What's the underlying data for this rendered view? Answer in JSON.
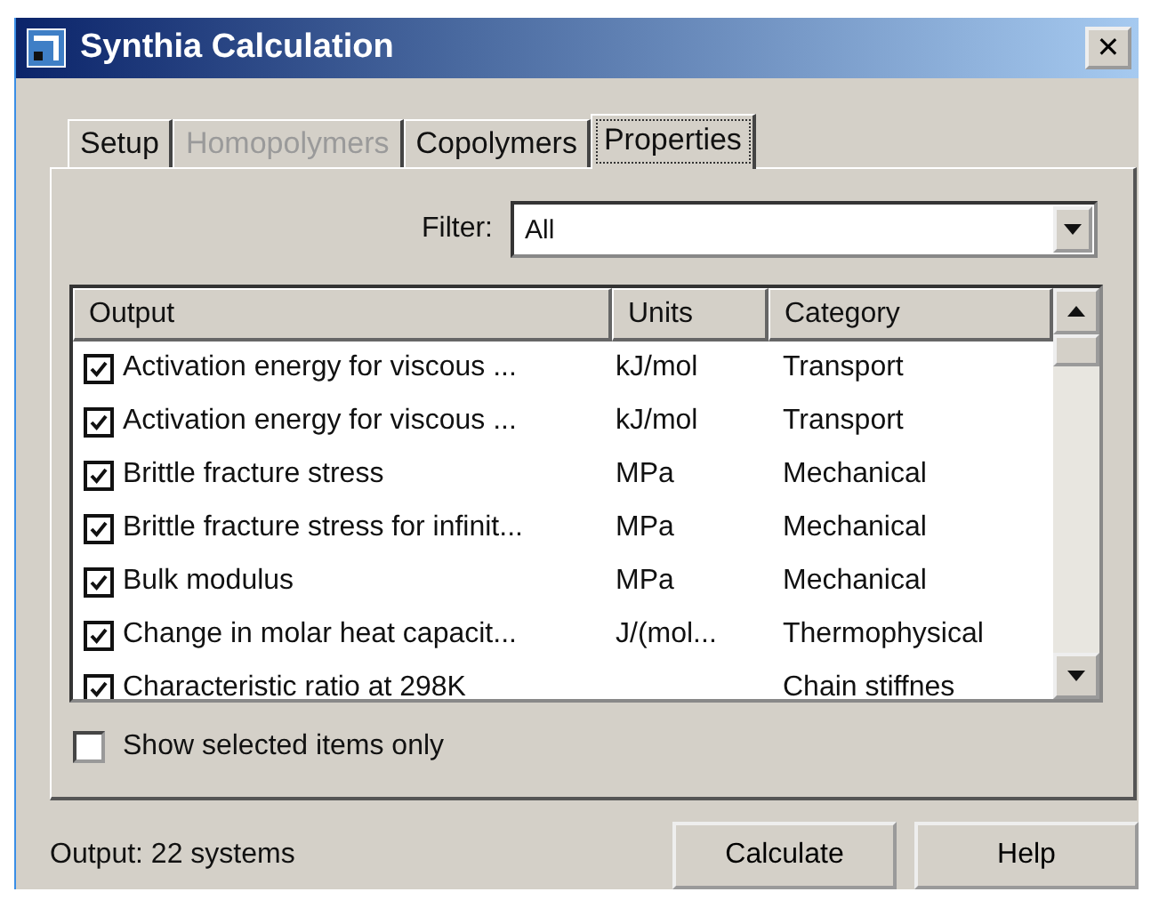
{
  "window": {
    "title": "Synthia Calculation",
    "close": "✕"
  },
  "tabs": [
    {
      "label": "Setup",
      "selected": false,
      "disabled": false
    },
    {
      "label": "Homopolymers",
      "selected": false,
      "disabled": true
    },
    {
      "label": "Copolymers",
      "selected": false,
      "disabled": false
    },
    {
      "label": "Properties",
      "selected": true,
      "disabled": false
    }
  ],
  "filter": {
    "label": "Filter:",
    "value": "All"
  },
  "table": {
    "columns": [
      "Output",
      "Units",
      "Category"
    ],
    "rows": [
      {
        "output": "Activation energy for viscous ...",
        "units": "kJ/mol",
        "category": "Transport",
        "checked": true
      },
      {
        "output": "Activation energy for viscous ...",
        "units": "kJ/mol",
        "category": "Transport",
        "checked": true
      },
      {
        "output": "Brittle fracture stress",
        "units": "MPa",
        "category": "Mechanical",
        "checked": true
      },
      {
        "output": "Brittle fracture stress for infinit...",
        "units": "MPa",
        "category": "Mechanical",
        "checked": true
      },
      {
        "output": "Bulk modulus",
        "units": "MPa",
        "category": "Mechanical",
        "checked": true
      },
      {
        "output": "Change in molar heat capacit...",
        "units": "J/(mol...",
        "category": "Thermophysical",
        "checked": true
      },
      {
        "output": "Characteristic ratio at 298K",
        "units": "",
        "category": "Chain stiffnes",
        "checked": true
      }
    ]
  },
  "show_selected_only": {
    "label": "Show selected items only",
    "checked": false
  },
  "status": "Output: 22 systems",
  "buttons": [
    "Calculate",
    "Help"
  ]
}
